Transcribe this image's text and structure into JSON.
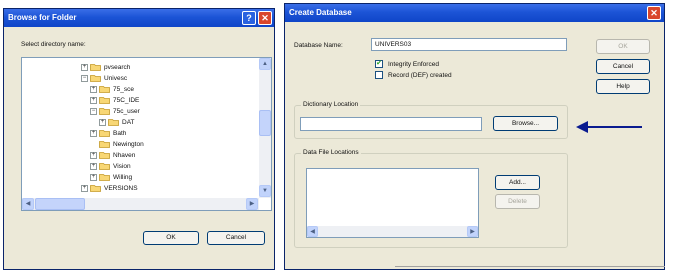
{
  "browse_dialog": {
    "title": "Browse for Folder",
    "help_symbol": "?",
    "close_symbol": "✕",
    "prompt": "Select directory name:",
    "tree": [
      {
        "label": "pvsearch",
        "depth": 1,
        "exp": "+"
      },
      {
        "label": "Univesc",
        "depth": 1,
        "exp": "−"
      },
      {
        "label": "75_sce",
        "depth": 2,
        "exp": "+"
      },
      {
        "label": "75C_IDE",
        "depth": 2,
        "exp": "+"
      },
      {
        "label": "75c_user",
        "depth": 2,
        "exp": "−"
      },
      {
        "label": "DAT",
        "depth": 3,
        "exp": "+"
      },
      {
        "label": "Bath",
        "depth": 2,
        "exp": "+"
      },
      {
        "label": "Newington",
        "depth": 2,
        "exp": ""
      },
      {
        "label": "Nhaven",
        "depth": 2,
        "exp": "+"
      },
      {
        "label": "Vision",
        "depth": 2,
        "exp": "+"
      },
      {
        "label": "Willing",
        "depth": 2,
        "exp": "+"
      },
      {
        "label": "VERSIONS",
        "depth": 1,
        "exp": "+"
      }
    ],
    "ok_label": "OK",
    "cancel_label": "Cancel"
  },
  "create_dialog": {
    "title": "Create Database",
    "close_symbol": "✕",
    "db_name_label": "Database Name:",
    "db_name_value": "UNIVERS03",
    "integrity_label": "Integrity Enforced",
    "integrity_checked": "✔",
    "record_label": "Record (DEF) created",
    "ok_label": "OK",
    "cancel_label": "Cancel",
    "help_label": "Help",
    "dict_group_label": "Dictionary Location",
    "dict_value": "",
    "browse_label": "Browse...",
    "data_group_label": "Data File Locations",
    "add_label": "Add...",
    "delete_label": "Delete"
  },
  "annotation": {
    "arrow_color": "#0a1b8f"
  },
  "colors": {
    "titlebar": "#1c54d6",
    "dialog_bg": "#ece9d8",
    "close_red": "#d9462c"
  }
}
